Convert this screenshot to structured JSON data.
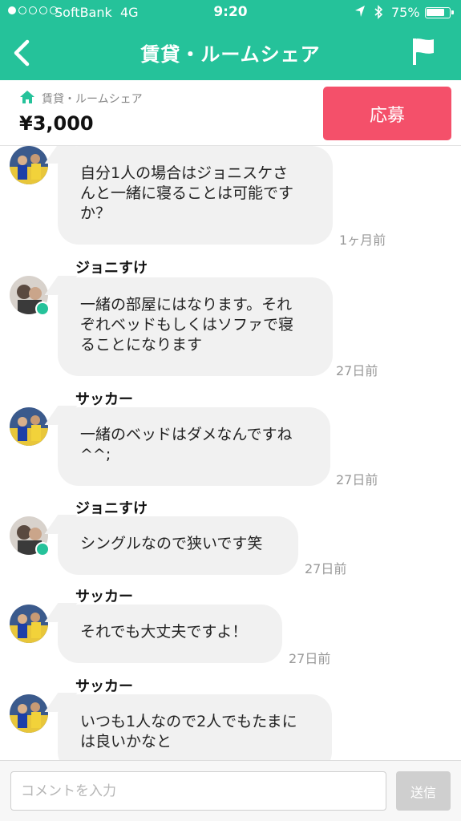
{
  "status_bar": {
    "carrier": "SoftBank",
    "network": "4G",
    "time": "9:20",
    "battery": "75%",
    "signal_icon": "signal-dots-icon",
    "location_icon": "location-arrow-icon",
    "bluetooth_icon": "bluetooth-icon",
    "battery_icon": "battery-icon"
  },
  "nav": {
    "title": "賃貸・ルームシェア",
    "back_icon": "chevron-left-icon",
    "report_icon": "flag-icon"
  },
  "listing": {
    "category": "賃貸・ルームシェア",
    "category_icon": "home-icon",
    "price": "¥3,000",
    "apply_label": "応募",
    "apply_color": "#f4506a"
  },
  "theme": {
    "accent": "#25c29a"
  },
  "messages": [
    {
      "sender": "",
      "text": "自分1人の場合はジョニスケさ\nんと一緒に寝ることは可能です\nか？",
      "time": "1ヶ月前"
    },
    {
      "sender": "ジョニすけ",
      "text": "一緒の部屋にはなります。それ\nぞれベッドもしくはソファで寝\nることになります",
      "time": "27日前"
    },
    {
      "sender": "サッカー",
      "text": "一緒のベッドはダメなんですね\n^^;",
      "time": "27日前"
    },
    {
      "sender": "ジョニすけ",
      "text": "シングルなので狭いです笑",
      "time": "27日前"
    },
    {
      "sender": "サッカー",
      "text": "それでも大丈夫ですよ！",
      "time": "27日前"
    },
    {
      "sender": "サッカー",
      "text": "いつも1人なので2人でもたまに\nは良いかなと",
      "time": ""
    }
  ],
  "composer": {
    "placeholder": "コメントを入力",
    "send_label": "送信"
  }
}
